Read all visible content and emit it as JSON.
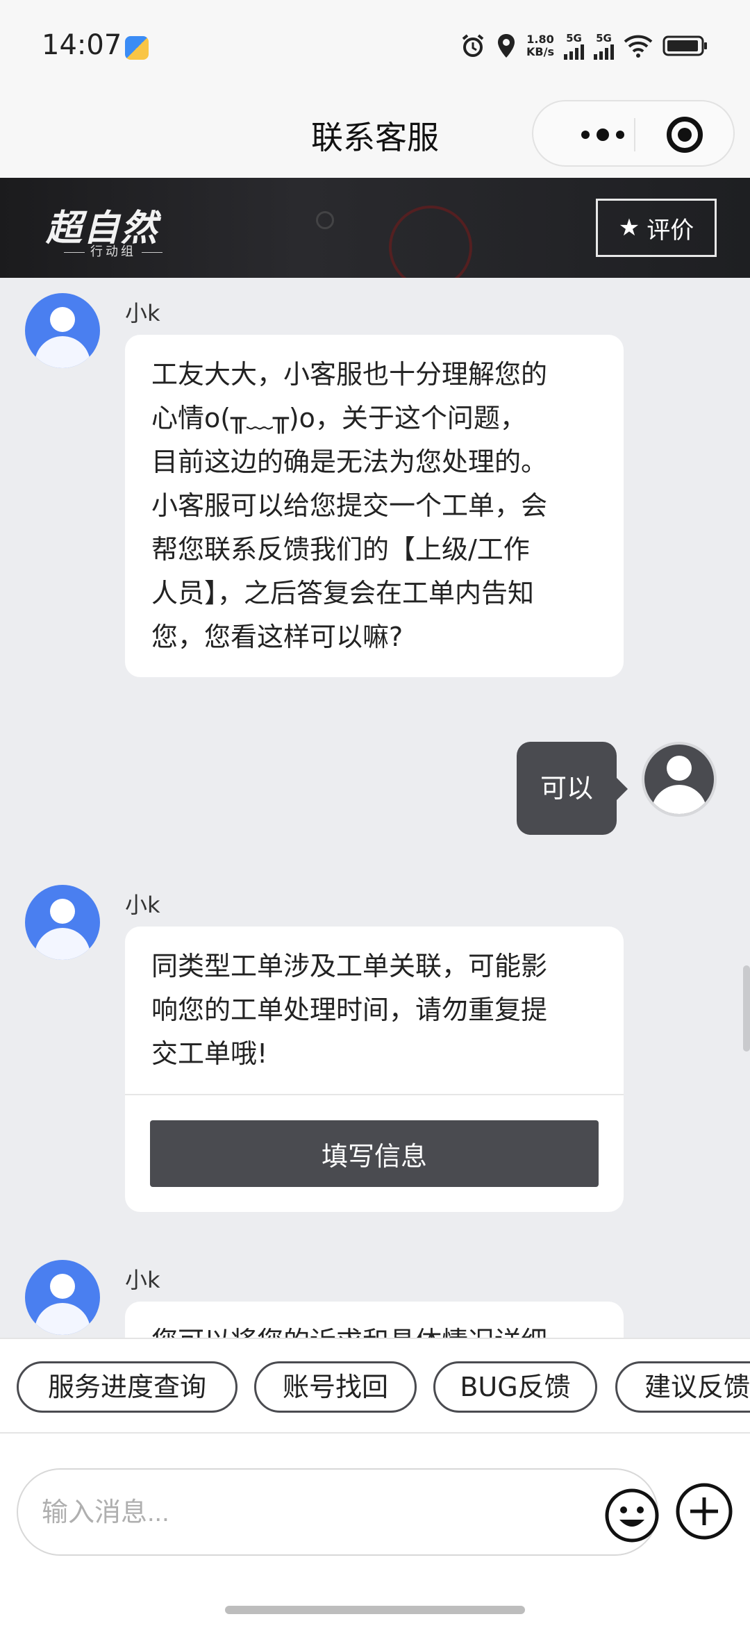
{
  "status_bar": {
    "time": "14:07",
    "net_speed_value": "1.80",
    "net_speed_unit": "KB/s",
    "sim1": "5G",
    "sim2": "5G"
  },
  "header": {
    "title": "联系客服"
  },
  "banner": {
    "logo_main": "超自然",
    "logo_sub": "行动组",
    "rate_label": "评价"
  },
  "messages": [
    {
      "side": "left",
      "sender": "小k",
      "text": "工友大大，小客服也十分理解您的\n心情o(╥﹏╥)o，关于这个问题，\n目前这边的确是无法为您处理的。\n小客服可以给您提交一个工单，会\n帮您联系反馈我们的【上级/工作\n人员】，之后答复会在工单内告知\n您，您看这样可以嘛?"
    },
    {
      "side": "right",
      "text": "可以"
    },
    {
      "side": "left",
      "sender": "小k",
      "text": "同类型工单涉及工单关联，可能影\n响您的工单处理时间，请勿重复提\n交工单哦!",
      "button": "填写信息"
    },
    {
      "side": "left",
      "sender": "小k",
      "text": "您可以将您的诉求和具体情况详细"
    }
  ],
  "quick_replies": [
    "服务进度查询",
    "账号找回",
    "BUG反馈",
    "建议反馈"
  ],
  "input": {
    "placeholder": "输入消息..."
  },
  "colors": {
    "dark_gray": "#4A4B50",
    "accent_blue": "#4A7FF0",
    "chat_bg": "#ECEDF0"
  }
}
